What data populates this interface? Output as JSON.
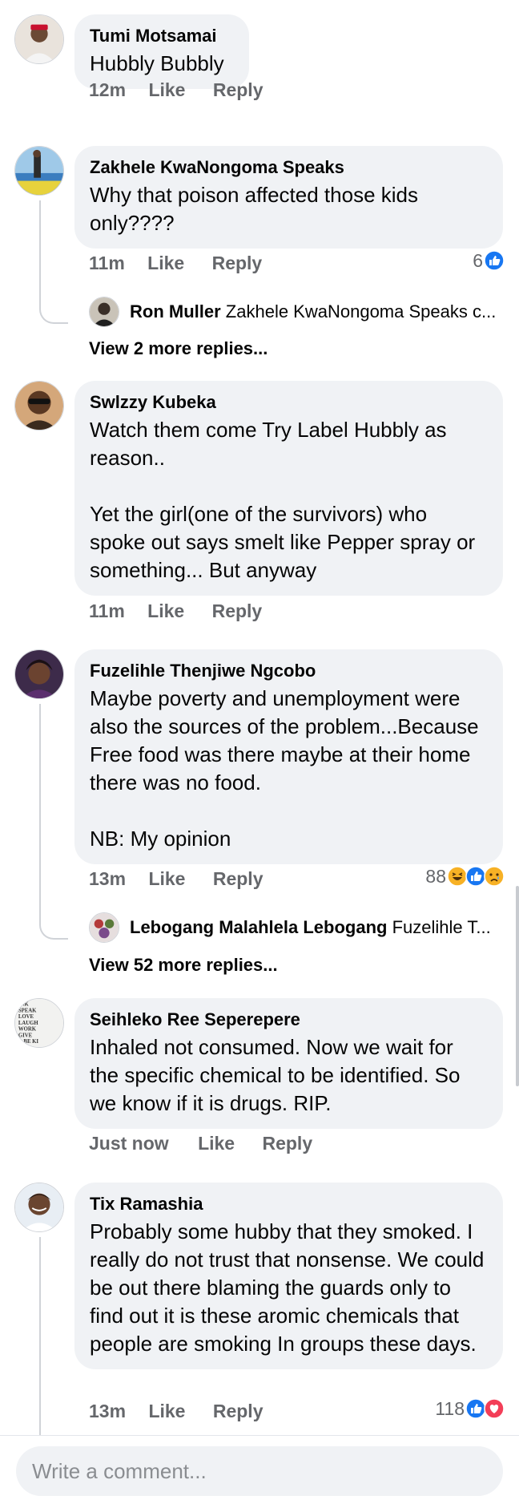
{
  "comments": [
    {
      "name": "Tumi Motsamai",
      "text": "Hubbly Bubbly",
      "time": "12m",
      "like": "Like",
      "reply": "Reply"
    },
    {
      "name": "Zakhele KwaNongoma Speaks",
      "text": "Why that poison affected those kids only????",
      "time": "11m",
      "like": "Like",
      "reply": "Reply",
      "reaction_count": "6",
      "reactions": [
        "like-icon"
      ],
      "reply_preview": {
        "name": "Ron Muller",
        "text": "Zakhele KwaNongoma Speaks c..."
      },
      "view_more": "View 2 more replies..."
    },
    {
      "name": "Swlzzy Kubeka",
      "text_lines": [
        "Watch them come Try Label Hubbly as reason..",
        "Yet the girl(one of the survivors) who spoke out says smelt like Pepper spray or something... But anyway"
      ],
      "time": "11m",
      "like": "Like",
      "reply": "Reply"
    },
    {
      "name": "Fuzelihle Thenjiwe Ngcobo",
      "text_lines": [
        "Maybe poverty and unemployment were also the sources of the problem...Because Free food was there maybe at their home there was no food.",
        "NB: My opinion"
      ],
      "time": "13m",
      "like": "Like",
      "reply": "Reply",
      "reaction_count": "88",
      "reactions": [
        "haha-icon",
        "like-icon",
        "sad-icon"
      ],
      "reply_preview": {
        "name": "Lebogang Malahlela Lebogang",
        "text": "Fuzelihle T..."
      },
      "view_more": "View 52 more replies..."
    },
    {
      "name": "Seihleko Ree Seperepere",
      "text": "Inhaled not consumed. Now we wait for the specific chemical to be identified. So we know if it is drugs. RIP.",
      "time": "Just now",
      "like": "Like",
      "reply": "Reply",
      "avatar_text": [
        "INK",
        "SPEAK",
        "LOVE",
        "LAUGH",
        "WORK",
        "GIVE",
        "D BE KI"
      ]
    },
    {
      "name": "Tix Ramashia",
      "text": "Probably some hubby that they smoked. I really do not trust that nonsense. We could be out there blaming the guards only to find out it is these aromic chemicals that people are smoking In groups these days.",
      "time": "13m",
      "like": "Like",
      "reply": "Reply",
      "reaction_count": "118",
      "reactions": [
        "like-icon",
        "love-icon"
      ]
    }
  ],
  "composer": {
    "placeholder": "Write a comment..."
  },
  "colors": {
    "bubble": "#f0f2f5",
    "secondary_text": "#65676b",
    "like_blue": "#1877f2",
    "love_red": "#f33e58",
    "emoji_yellow": "#f7b125"
  }
}
